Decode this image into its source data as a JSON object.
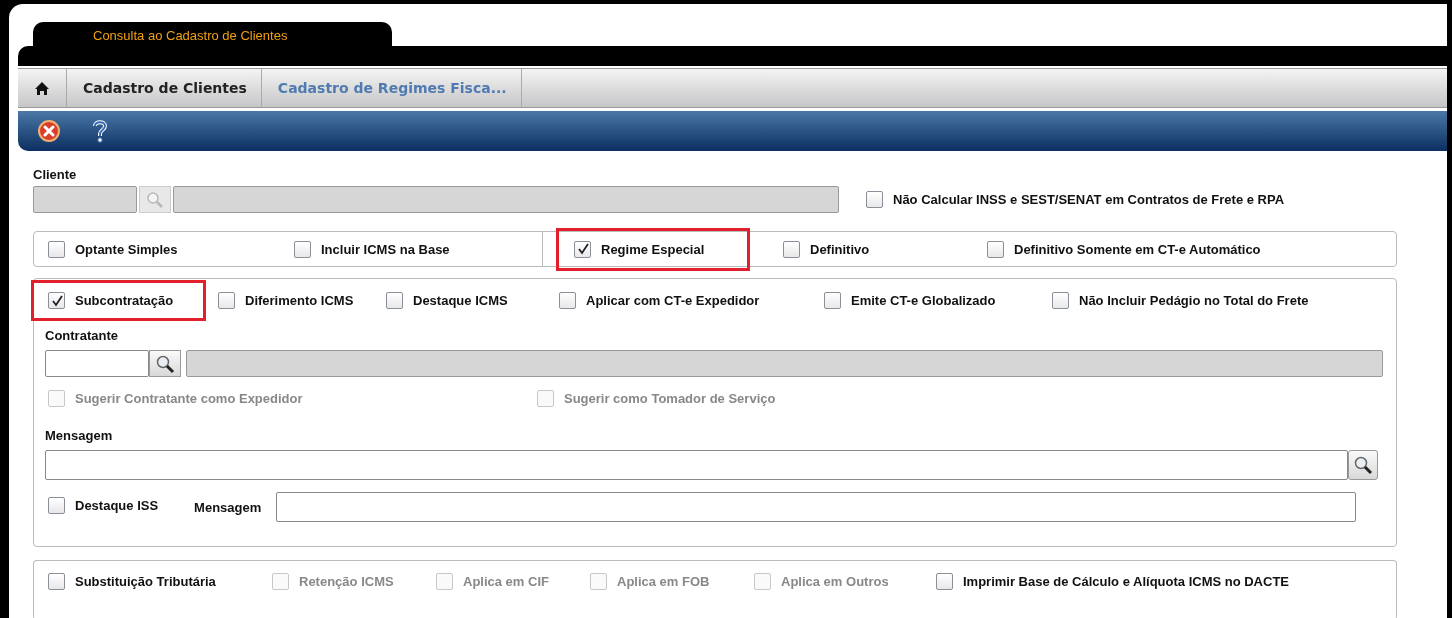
{
  "tab": {
    "label": "Consulta ao Cadastro de Clientes"
  },
  "breadcrumb": [
    {
      "label": "Cadastro de Clientes",
      "selected": false
    },
    {
      "label": "Cadastro de Regimes Fisca...",
      "selected": true
    }
  ],
  "cliente": {
    "label": "Cliente"
  },
  "nao_calcular": {
    "label": "Não Calcular INSS e SEST/SENAT em Contratos de Frete e RPA",
    "checked": false
  },
  "regime_row": [
    {
      "label": "Optante Simples",
      "checked": false,
      "highlighted": false
    },
    {
      "label": "Incluir ICMS na Base",
      "checked": false,
      "highlighted": false
    },
    {
      "label": "Regime Especial",
      "checked": true,
      "highlighted": true
    },
    {
      "label": "Definitivo",
      "checked": false,
      "highlighted": false
    },
    {
      "label": "Definitivo Somente em CT-e Automático",
      "checked": false,
      "highlighted": false
    }
  ],
  "options_row": [
    {
      "label": "Subcontratação",
      "checked": true,
      "highlighted": true
    },
    {
      "label": "Diferimento ICMS",
      "checked": false,
      "highlighted": false
    },
    {
      "label": "Destaque ICMS",
      "checked": false,
      "highlighted": false
    },
    {
      "label": "Aplicar com CT-e Expedidor",
      "checked": false,
      "highlighted": false
    },
    {
      "label": "Emite CT-e Globalizado",
      "checked": false,
      "highlighted": false
    },
    {
      "label": "Não Incluir Pedágio no Total do Frete",
      "checked": false,
      "highlighted": false
    }
  ],
  "contratante": {
    "label": "Contratante"
  },
  "sugerir": [
    {
      "label": "Sugerir Contratante como Expedidor",
      "checked": false,
      "disabled": true
    },
    {
      "label": "Sugerir como Tomador de Serviço",
      "checked": false,
      "disabled": true
    }
  ],
  "mensagem": {
    "label": "Mensagem"
  },
  "destaque_iss": {
    "label": "Destaque ISS",
    "checked": false
  },
  "mensagem_iss": {
    "label": "Mensagem"
  },
  "substituicao_row": [
    {
      "label": "Substituição Tributária",
      "checked": false,
      "disabled": false
    },
    {
      "label": "Retenção ICMS",
      "checked": false,
      "disabled": true
    },
    {
      "label": "Aplica em CIF",
      "checked": false,
      "disabled": true
    },
    {
      "label": "Aplica em FOB",
      "checked": false,
      "disabled": true
    },
    {
      "label": "Aplica em Outros",
      "checked": false,
      "disabled": true
    },
    {
      "label": "Imprimir Base de Cálculo e Alíquota ICMS no DACTE",
      "checked": false,
      "disabled": false
    }
  ]
}
